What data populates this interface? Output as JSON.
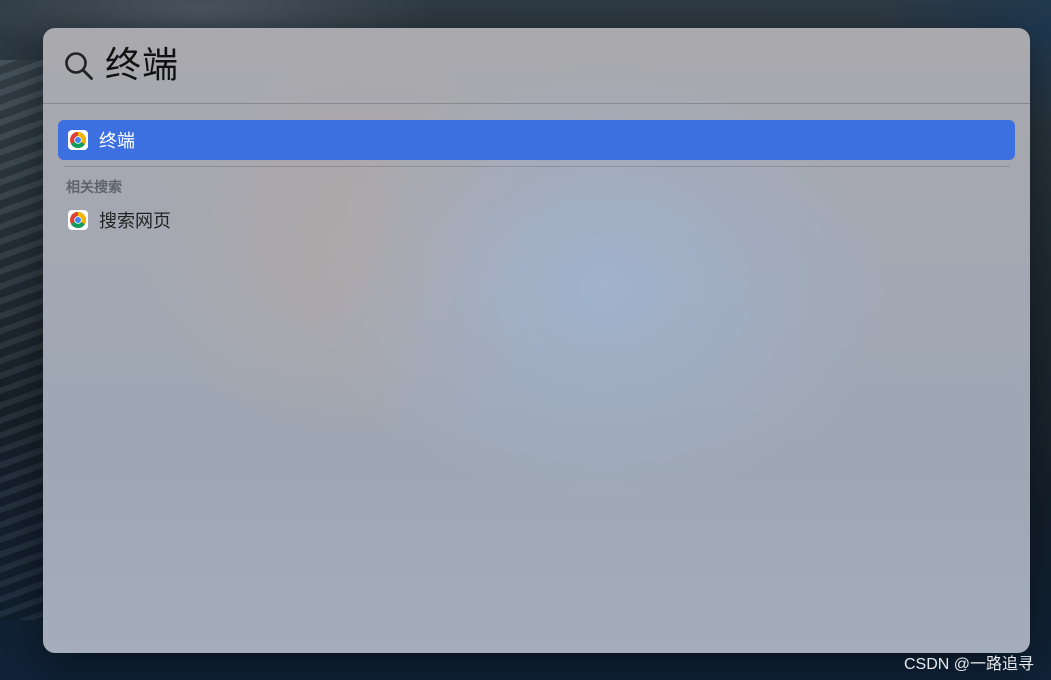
{
  "search": {
    "query": "终端"
  },
  "results": {
    "top_hit": {
      "label": "终端",
      "icon": "chrome-icon",
      "selected": true
    },
    "related_section": {
      "header": "相关搜索",
      "items": [
        {
          "label": "搜索网页",
          "icon": "chrome-icon"
        }
      ]
    }
  },
  "colors": {
    "selection": "#3c6fe0",
    "section_header": "#5f6470"
  },
  "watermark": "CSDN @一路追寻"
}
